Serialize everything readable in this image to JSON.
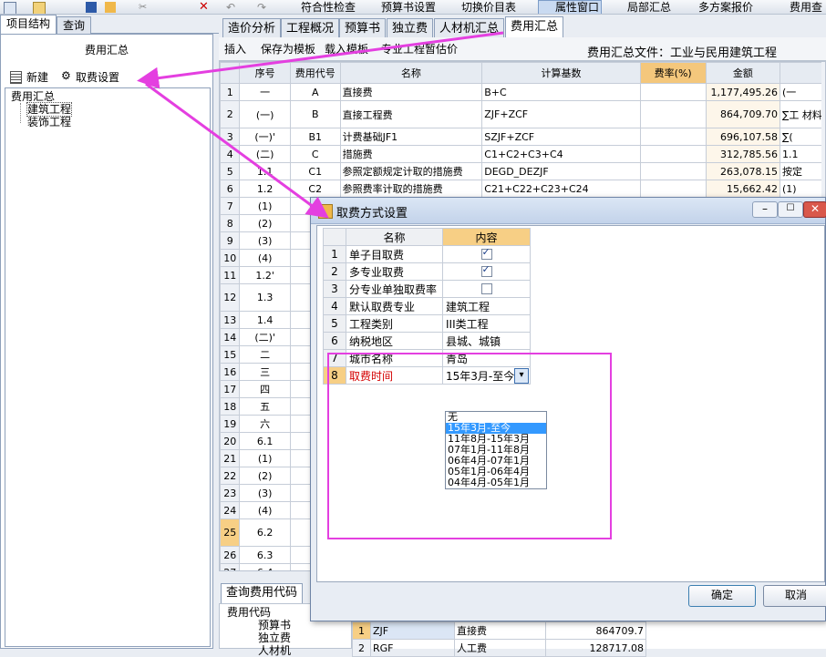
{
  "toolbar": {
    "items": [
      "符合性检查",
      "预算书设置",
      "切换价目表",
      "属性窗口",
      "局部汇总",
      "多方案报价",
      "费用查"
    ]
  },
  "left": {
    "tabs": [
      "项目结构",
      "查询"
    ],
    "panel_title": "费用汇总",
    "new_label": "新建",
    "settings_label": "取费设置",
    "tree": {
      "root": "费用汇总",
      "children": [
        "建筑工程",
        "装饰工程"
      ]
    }
  },
  "right": {
    "tabs": [
      "造价分析",
      "工程概况",
      "预算书",
      "独立费",
      "人材机汇总",
      "费用汇总"
    ],
    "active_tab": "费用汇总",
    "subtoolbar": [
      "插入",
      "保存为模板",
      "载入模板",
      "专业工程暂估价"
    ],
    "fee_file": "费用汇总文件：工业与民用建筑工程",
    "grid": {
      "headers": [
        "",
        "序号",
        "费用代号",
        "名称",
        "计算基数",
        "费率(%)",
        "金额",
        ""
      ],
      "rows": [
        {
          "n": "1",
          "seq": "一",
          "code": "A",
          "name": "直接费",
          "base": "B+C",
          "rate": "",
          "amount": "1,177,495.26",
          "extra": "(一"
        },
        {
          "n": "2",
          "seq": "(一)",
          "code": "B",
          "name": "直接工程费",
          "base": "ZJF+ZCF",
          "rate": "",
          "amount": "864,709.70",
          "extra": "∑工 材料"
        },
        {
          "n": "3",
          "seq": "(一)'",
          "code": "B1",
          "name": "计费基础JF1",
          "base": "SZJF+ZCF",
          "rate": "",
          "amount": "696,107.58",
          "extra": "∑("
        },
        {
          "n": "4",
          "seq": "(二)",
          "code": "C",
          "name": "措施费",
          "base": "C1+C2+C3+C4",
          "rate": "",
          "amount": "312,785.56",
          "extra": "1.1"
        },
        {
          "n": "5",
          "seq": "1.1",
          "code": "C1",
          "name": "参照定额规定计取的措施费",
          "base": "DEGD_DEZJF",
          "rate": "",
          "amount": "263,078.15",
          "extra": "按定"
        },
        {
          "n": "6",
          "seq": "1.2",
          "code": "C2",
          "name": "参照费率计取的措施费",
          "base": "C21+C22+C23+C24",
          "rate": "",
          "amount": "15,662.42",
          "extra": "(1)"
        },
        {
          "n": "7",
          "seq": "(1)",
          "code": "",
          "name": "",
          "base": "",
          "rate": "",
          "amount": "",
          "extra": ""
        },
        {
          "n": "8",
          "seq": "(2)",
          "code": "",
          "name": "",
          "base": "",
          "rate": "",
          "amount": "",
          "extra": ""
        },
        {
          "n": "9",
          "seq": "(3)",
          "code": "",
          "name": "",
          "base": "",
          "rate": "",
          "amount": "",
          "extra": ""
        },
        {
          "n": "10",
          "seq": "(4)",
          "code": "",
          "name": "",
          "base": "",
          "rate": "",
          "amount": "",
          "extra": ""
        },
        {
          "n": "11",
          "seq": "1.2'",
          "code": "",
          "name": "",
          "base": "",
          "rate": "",
          "amount": "",
          "extra": ""
        },
        {
          "n": "12",
          "seq": "1.3",
          "code": "",
          "name": "",
          "base": "",
          "rate": "",
          "amount": "",
          "extra": ""
        },
        {
          "n": "13",
          "seq": "1.4",
          "code": "",
          "name": "",
          "base": "",
          "rate": "",
          "amount": "",
          "extra": ""
        },
        {
          "n": "14",
          "seq": "(二)'",
          "code": "",
          "name": "",
          "base": "",
          "rate": "",
          "amount": "",
          "extra": ""
        },
        {
          "n": "15",
          "seq": "二",
          "code": "",
          "name": "",
          "base": "",
          "rate": "",
          "amount": "",
          "extra": ""
        },
        {
          "n": "16",
          "seq": "三",
          "code": "",
          "name": "",
          "base": "",
          "rate": "",
          "amount": "",
          "extra": ""
        },
        {
          "n": "17",
          "seq": "四",
          "code": "",
          "name": "",
          "base": "",
          "rate": "",
          "amount": "",
          "extra": ""
        },
        {
          "n": "18",
          "seq": "五",
          "code": "",
          "name": "",
          "base": "",
          "rate": "",
          "amount": "",
          "extra": ""
        },
        {
          "n": "19",
          "seq": "六",
          "code": "",
          "name": "",
          "base": "",
          "rate": "",
          "amount": "",
          "extra": ""
        },
        {
          "n": "20",
          "seq": "6.1",
          "code": "",
          "name": "",
          "base": "",
          "rate": "",
          "amount": "",
          "extra": ""
        },
        {
          "n": "21",
          "seq": "(1)",
          "code": "",
          "name": "",
          "base": "",
          "rate": "",
          "amount": "",
          "extra": ""
        },
        {
          "n": "22",
          "seq": "(2)",
          "code": "",
          "name": "",
          "base": "",
          "rate": "",
          "amount": "",
          "extra": ""
        },
        {
          "n": "23",
          "seq": "(3)",
          "code": "",
          "name": "",
          "base": "",
          "rate": "",
          "amount": "",
          "extra": ""
        },
        {
          "n": "24",
          "seq": "(4)",
          "code": "",
          "name": "",
          "base": "",
          "rate": "",
          "amount": "",
          "extra": ""
        },
        {
          "n": "25",
          "seq": "6.2",
          "code": "",
          "name": "",
          "base": "",
          "rate": "",
          "amount": "",
          "extra": ""
        },
        {
          "n": "26",
          "seq": "6.3",
          "code": "",
          "name": "",
          "base": "",
          "rate": "",
          "amount": "",
          "extra": ""
        },
        {
          "n": "27",
          "seq": "6.4",
          "code": "",
          "name": "",
          "base": "",
          "rate": "",
          "amount": "",
          "extra": ""
        }
      ]
    },
    "bottom_tab": "查询费用代码",
    "bottom_tree": [
      "费用代码",
      "预算书",
      "独立费",
      "人材机"
    ],
    "bottom_row": {
      "n": "1",
      "code": "ZJF",
      "name": "直接费",
      "value": "864709.7"
    },
    "bottom_row2": {
      "n": "2",
      "code": "RGF",
      "name": "人工费",
      "value": "128717.08"
    }
  },
  "dialog": {
    "title": "取费方式设置",
    "headers": [
      "名称",
      "内容"
    ],
    "rows": [
      {
        "n": "1",
        "name": "单子目取费",
        "value": "",
        "checked": true
      },
      {
        "n": "2",
        "name": "多专业取费",
        "value": "",
        "checked": true
      },
      {
        "n": "3",
        "name": "分专业单独取费率",
        "value": "",
        "checked": false
      },
      {
        "n": "4",
        "name": "默认取费专业",
        "value": "建筑工程"
      },
      {
        "n": "5",
        "name": "工程类别",
        "value": "III类工程"
      },
      {
        "n": "6",
        "name": "纳税地区",
        "value": "县城、城镇"
      },
      {
        "n": "7",
        "name": "城市名称",
        "value": "青岛"
      },
      {
        "n": "8",
        "name": "取费时间",
        "value": "15年3月-至今"
      }
    ],
    "dropdown_options": [
      "无",
      "15年3月-至今",
      "11年8月-15年3月",
      "07年1月-11年8月",
      "06年4月-07年1月",
      "05年1月-06年4月",
      "04年4月-05年1月"
    ],
    "selected_option": "15年3月-至今",
    "ok_label": "确定",
    "cancel_label": "取消"
  },
  "colors": {
    "annotation": "#e43fe0",
    "selected": "#3399ff",
    "header_highlight": "#f7cf85"
  }
}
